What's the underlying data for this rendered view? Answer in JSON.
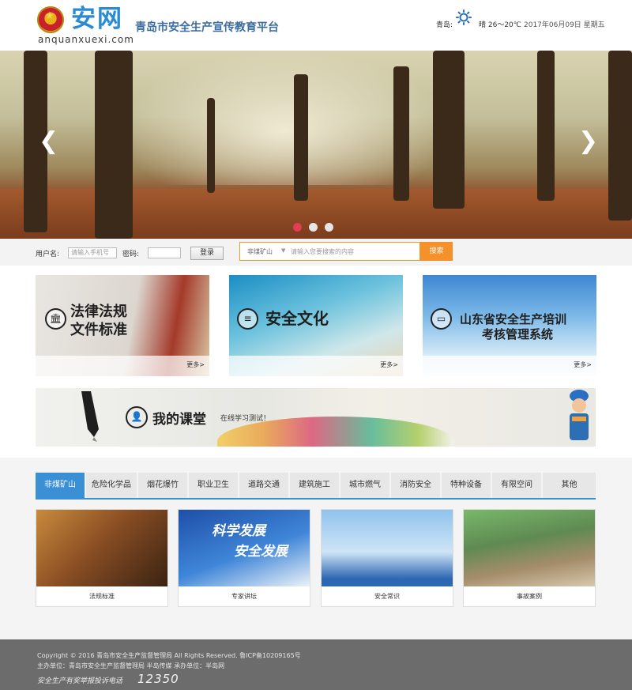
{
  "header": {
    "logo_text": "安网",
    "logo_domain": "anquanxuexi.com",
    "site_title": "青岛市安全生产宣传教育平台",
    "weather_city": "青岛:",
    "weather_icon": "sun-icon",
    "weather_text": "晴 26～20℃",
    "date_text": "2017年06月09日 星期五"
  },
  "hero": {
    "prev": "❮",
    "next": "❯",
    "slides_count": 3,
    "active_slide": 1
  },
  "login": {
    "user_label": "用户名:",
    "user_placeholder": "请输入手机号",
    "password_label": "密码:",
    "password_value": "",
    "login_button": "登录"
  },
  "search": {
    "category": "非煤矿山",
    "placeholder": "请输入您要搜索的内容",
    "button": "搜索"
  },
  "tiles": [
    {
      "title_line1": "法律法规",
      "title_line2": "文件标准",
      "icon": "bank-icon",
      "more": "更多>"
    },
    {
      "title_line1": "安全文化",
      "title_line2": "",
      "icon": "book-stack-icon",
      "more": "更多>"
    },
    {
      "title_line1": "山东省安全生产培训",
      "title_line2": "考核管理系统",
      "icon": "monitor-icon",
      "more": "更多>"
    }
  ],
  "classroom": {
    "title": "我的课堂",
    "subtitle": "在线学习测试！",
    "icon": "person-icon"
  },
  "tabs": [
    "非煤矿山",
    "危险化学品",
    "烟花爆竹",
    "职业卫生",
    "道路交通",
    "建筑施工",
    "城市燃气",
    "消防安全",
    "特种设备",
    "有限空间",
    "其他"
  ],
  "active_tab": 0,
  "cards": [
    {
      "label": "法规标准"
    },
    {
      "label": "专家讲坛",
      "banner_line1": "科学发展",
      "banner_line2": "安全发展"
    },
    {
      "label": "安全常识"
    },
    {
      "label": "事故案例"
    }
  ],
  "footer": {
    "line1": "Copyright © 2016 青岛市安全生产监督管理局 All Rights Reserved. 鲁ICP备10209165号",
    "line2": "主办单位：青岛市安全生产监督管理局 半岛传媒 承办单位：半岛网",
    "hotline_label": "安全生产有奖举报投诉电话",
    "hotline_number": "12350"
  },
  "colors": {
    "brand_blue": "#3b8fd4",
    "search_orange": "#f4912a",
    "active_dot": "#e53c55"
  }
}
